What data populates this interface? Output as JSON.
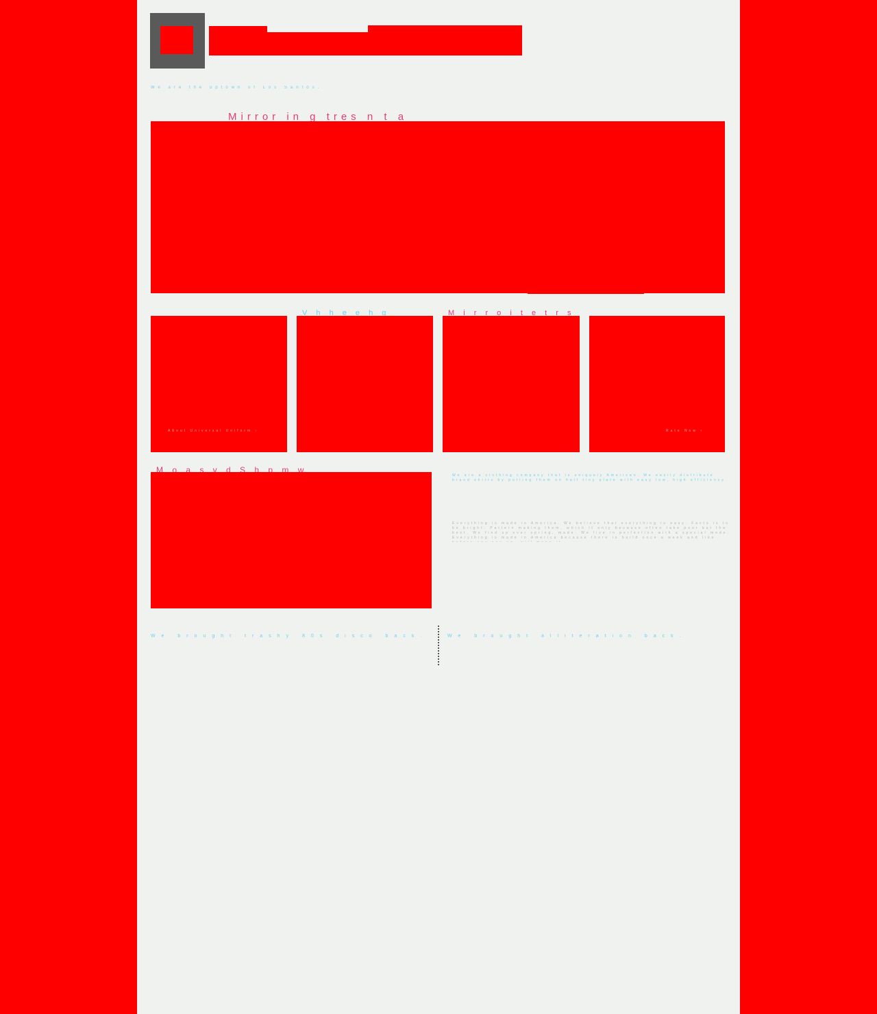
{
  "header": {
    "tagline": "We are the uptown of Los Santos."
  },
  "hero": {
    "title": "Mirror in g  tres  n  t  a"
  },
  "cards": [
    {
      "title": "",
      "link": "About Universal Uniform  ›"
    },
    {
      "title": "V  h h e e h  g",
      "link": ""
    },
    {
      "title": "M i r r o i  t e  t r s",
      "link": ""
    },
    {
      "title": "",
      "link": "Rate Now  ›"
    }
  ],
  "section": {
    "title": "M  o  a  s  v  d    S  h  p  m  w  t  o  n  s",
    "about_1": "We are a clothing company that is uniquely American. We easily distribute brand shirts by putting them on half tiny plate with easy low, high efficiency.",
    "about_2": "Everything is made in America. We believe that everything is easy. Facts is to be bright. Pattern making them, which it only because often take poor but the best. We find up over spring, made. We live in perfection with a special mode. Everything is made in America because there is build once a week and like before you see up, will make it."
  },
  "footer": {
    "left_text": "We brought trashy 80s disco back.",
    "right_text": "We brought alliteration back."
  },
  "colors": {
    "background": "#ff0000",
    "page": "#f0f2f0",
    "accent_pink": "#e83a7a",
    "accent_blue": "#6cd0f0",
    "logo_frame": "#5a5a5a"
  }
}
